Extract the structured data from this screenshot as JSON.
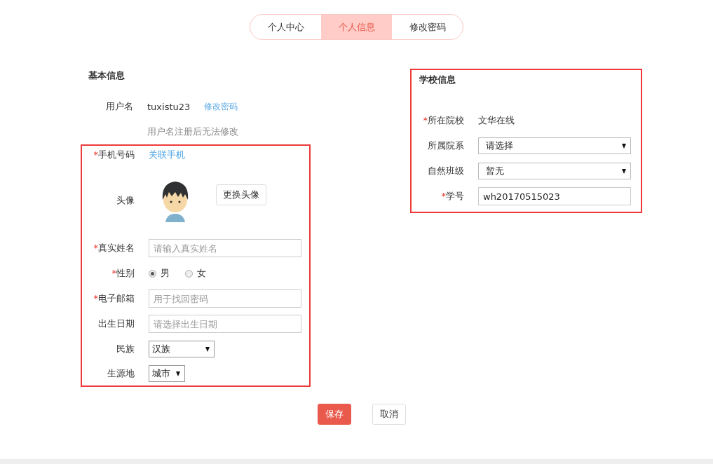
{
  "tabs": [
    {
      "label": "个人中心",
      "selected": false
    },
    {
      "label": "个人信息",
      "selected": true
    },
    {
      "label": "修改密码",
      "selected": false
    }
  ],
  "basic": {
    "title": "基本信息",
    "top_rows": [
      {
        "kind": "text",
        "label": "用户名",
        "value": "tuxistu23",
        "link": "修改密码"
      },
      {
        "kind": "hint",
        "label": "",
        "value": "用户名注册后无法修改"
      }
    ],
    "highlighted_rows": [
      {
        "kind": "link",
        "label": "手机号码",
        "required_mark": "*",
        "value": "关联手机"
      },
      {
        "kind": "avatar",
        "label": "头像",
        "button": "更换头像"
      },
      {
        "kind": "input",
        "label": "真实姓名",
        "required_mark": "*",
        "placeholder": "请输入真实姓名"
      },
      {
        "kind": "radio",
        "label": "性别",
        "required_mark": "*",
        "options": [
          {
            "label": "男",
            "selected": true
          },
          {
            "label": "女",
            "selected": false
          }
        ]
      },
      {
        "kind": "input",
        "label": "电子邮箱",
        "required_mark": "*",
        "placeholder": "用于找回密码"
      },
      {
        "kind": "input",
        "label": "出生日期",
        "placeholder": "请选择出生日期"
      },
      {
        "kind": "select",
        "label": "民族",
        "value": "汉族"
      },
      {
        "kind": "select",
        "label": "生源地",
        "value": "城市"
      }
    ]
  },
  "school": {
    "title": "学校信息",
    "rows": [
      {
        "kind": "text",
        "label": "所在院校",
        "required_mark": "*",
        "value": "文华在线"
      },
      {
        "kind": "select",
        "label": "所属院系",
        "value": "请选择"
      },
      {
        "kind": "select",
        "label": "自然班级",
        "value": "暂无"
      },
      {
        "kind": "value_input",
        "label": "学号",
        "required_mark": "*",
        "value": "wh20170515023"
      }
    ]
  },
  "buttons": [
    {
      "label": "保存",
      "kind": "primary"
    },
    {
      "label": "取消",
      "kind": "default"
    }
  ]
}
